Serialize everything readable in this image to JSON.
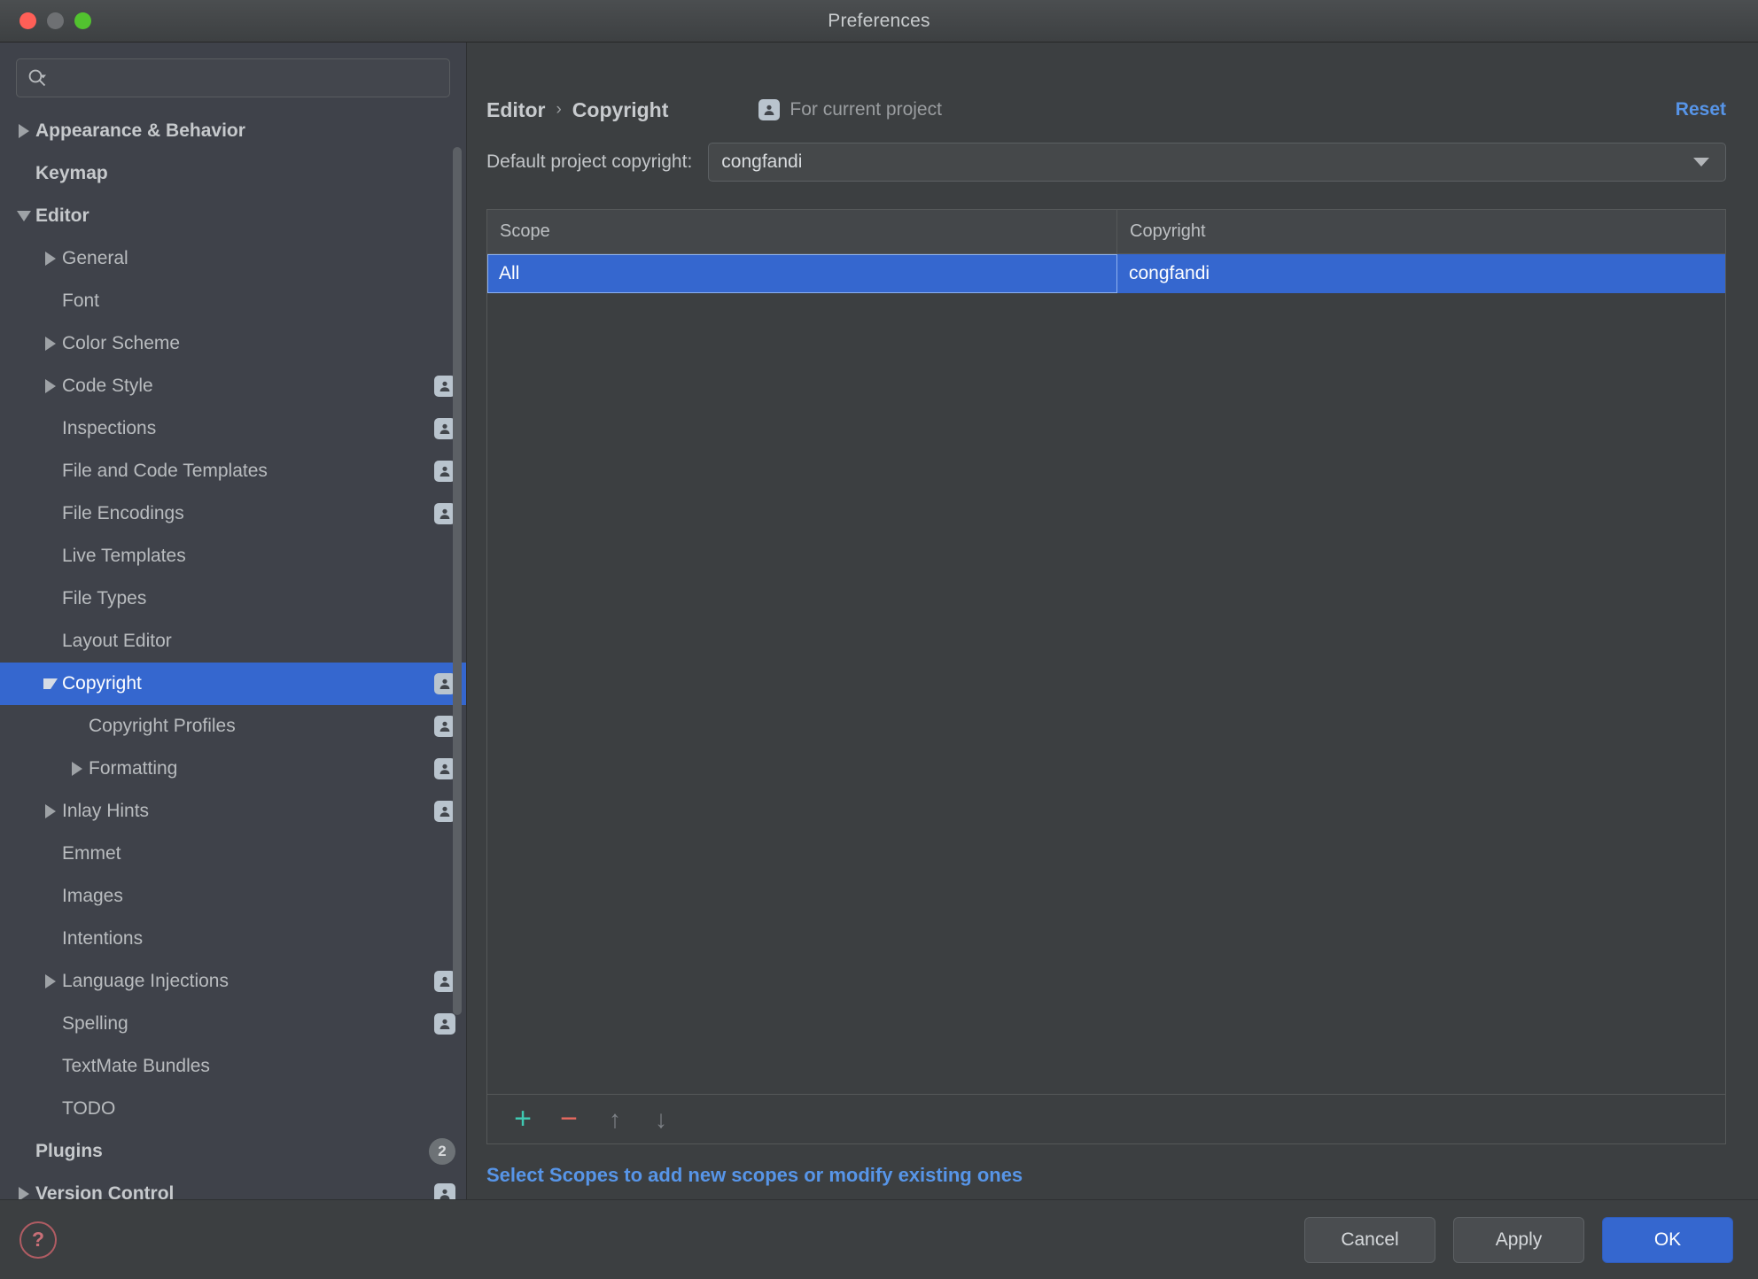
{
  "window": {
    "title": "Preferences",
    "traffic_lights": [
      "close",
      "minimize",
      "zoom"
    ]
  },
  "search": {
    "placeholder": "",
    "value": "",
    "icon": "search-icon"
  },
  "sidebar": {
    "items": [
      {
        "label": "Appearance & Behavior",
        "indent": 0,
        "arrow": "right",
        "bold": true,
        "badge": "none",
        "selected": false
      },
      {
        "label": "Keymap",
        "indent": 0,
        "arrow": "none",
        "bold": true,
        "badge": "none",
        "selected": false
      },
      {
        "label": "Editor",
        "indent": 0,
        "arrow": "down",
        "bold": true,
        "badge": "none",
        "selected": false
      },
      {
        "label": "General",
        "indent": 1,
        "arrow": "right",
        "bold": false,
        "badge": "none",
        "selected": false
      },
      {
        "label": "Font",
        "indent": 1,
        "arrow": "none",
        "bold": false,
        "badge": "none",
        "selected": false
      },
      {
        "label": "Color Scheme",
        "indent": 1,
        "arrow": "right",
        "bold": false,
        "badge": "none",
        "selected": false
      },
      {
        "label": "Code Style",
        "indent": 1,
        "arrow": "right",
        "bold": false,
        "badge": "person",
        "selected": false
      },
      {
        "label": "Inspections",
        "indent": 1,
        "arrow": "none",
        "bold": false,
        "badge": "person",
        "selected": false
      },
      {
        "label": "File and Code Templates",
        "indent": 1,
        "arrow": "none",
        "bold": false,
        "badge": "person",
        "selected": false
      },
      {
        "label": "File Encodings",
        "indent": 1,
        "arrow": "none",
        "bold": false,
        "badge": "person",
        "selected": false
      },
      {
        "label": "Live Templates",
        "indent": 1,
        "arrow": "none",
        "bold": false,
        "badge": "none",
        "selected": false
      },
      {
        "label": "File Types",
        "indent": 1,
        "arrow": "none",
        "bold": false,
        "badge": "none",
        "selected": false
      },
      {
        "label": "Layout Editor",
        "indent": 1,
        "arrow": "none",
        "bold": false,
        "badge": "none",
        "selected": false
      },
      {
        "label": "Copyright",
        "indent": 1,
        "arrow": "down",
        "bold": false,
        "badge": "person",
        "selected": true
      },
      {
        "label": "Copyright Profiles",
        "indent": 2,
        "arrow": "none",
        "bold": false,
        "badge": "person",
        "selected": false
      },
      {
        "label": "Formatting",
        "indent": 2,
        "arrow": "right",
        "bold": false,
        "badge": "person",
        "selected": false
      },
      {
        "label": "Inlay Hints",
        "indent": 1,
        "arrow": "right",
        "bold": false,
        "badge": "person",
        "selected": false
      },
      {
        "label": "Emmet",
        "indent": 1,
        "arrow": "none",
        "bold": false,
        "badge": "none",
        "selected": false
      },
      {
        "label": "Images",
        "indent": 1,
        "arrow": "none",
        "bold": false,
        "badge": "none",
        "selected": false
      },
      {
        "label": "Intentions",
        "indent": 1,
        "arrow": "none",
        "bold": false,
        "badge": "none",
        "selected": false
      },
      {
        "label": "Language Injections",
        "indent": 1,
        "arrow": "right",
        "bold": false,
        "badge": "person",
        "selected": false
      },
      {
        "label": "Spelling",
        "indent": 1,
        "arrow": "none",
        "bold": false,
        "badge": "person",
        "selected": false
      },
      {
        "label": "TextMate Bundles",
        "indent": 1,
        "arrow": "none",
        "bold": false,
        "badge": "none",
        "selected": false
      },
      {
        "label": "TODO",
        "indent": 1,
        "arrow": "none",
        "bold": false,
        "badge": "none",
        "selected": false
      },
      {
        "label": "Plugins",
        "indent": 0,
        "arrow": "none",
        "bold": true,
        "badge": "count",
        "badge_count": "2",
        "selected": false
      },
      {
        "label": "Version Control",
        "indent": 0,
        "arrow": "right",
        "bold": true,
        "badge": "person",
        "selected": false
      }
    ]
  },
  "header": {
    "breadcrumb_parent": "Editor",
    "breadcrumb_sep": "›",
    "breadcrumb_current": "Copyright",
    "scope_note": "For current project",
    "scope_icon": "person-badge-icon",
    "reset_label": "Reset"
  },
  "default_copyright": {
    "label": "Default project copyright:",
    "value": "congfandi"
  },
  "table": {
    "columns": [
      "Scope",
      "Copyright"
    ],
    "rows": [
      {
        "scope": "All",
        "copyright": "congfandi",
        "selected": true
      }
    ],
    "toolbar": [
      {
        "name": "add-scope-button",
        "glyph": "+"
      },
      {
        "name": "remove-scope-button",
        "glyph": "−"
      },
      {
        "name": "move-up-button",
        "glyph": "↑"
      },
      {
        "name": "move-down-button",
        "glyph": "↓"
      }
    ]
  },
  "hint": {
    "text": "Select Scopes to add new scopes or modify existing ones"
  },
  "footer": {
    "help_glyph": "?",
    "cancel_label": "Cancel",
    "apply_label": "Apply",
    "ok_label": "OK"
  },
  "colors": {
    "accent_selection": "#3567cf",
    "link": "#5795e8",
    "window_bg": "#3c3f41",
    "sidebar_bg": "#3f424a",
    "add_icon": "#3fc9b2",
    "remove_icon": "#e8695f"
  }
}
